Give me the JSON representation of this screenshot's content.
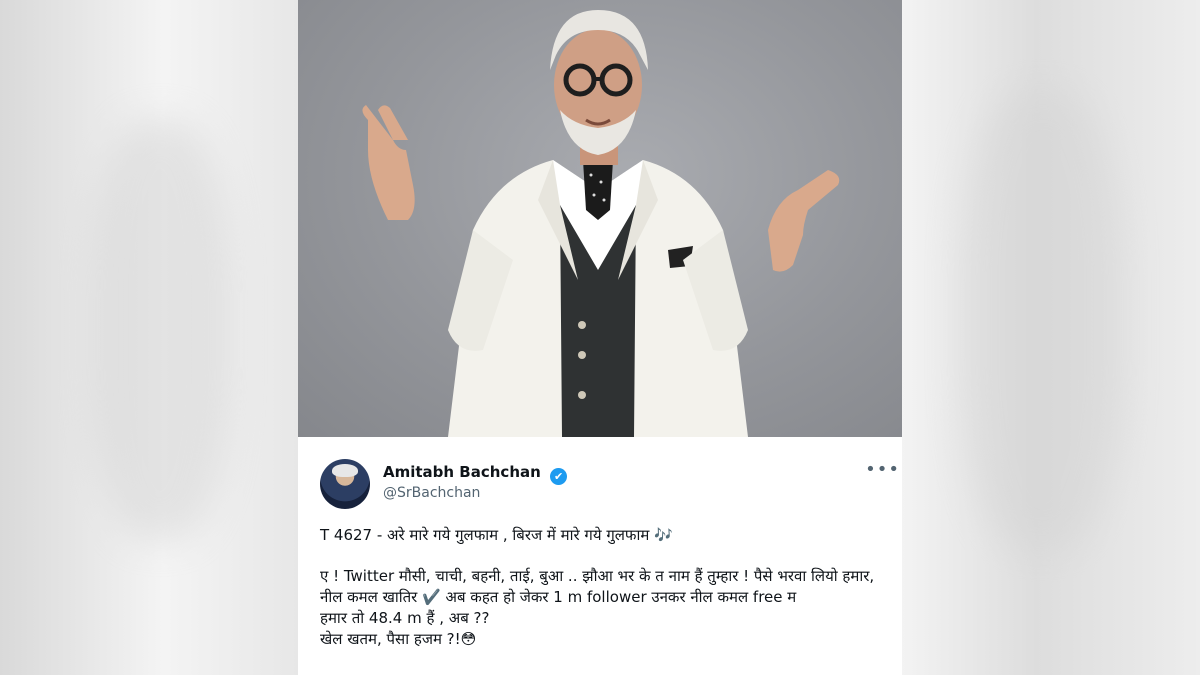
{
  "tweet": {
    "author_name": "Amitabh Bachchan",
    "verified_icon": "✔",
    "handle": "@SrBachchan",
    "more_icon": "•••",
    "line1": "T 4627 - अरे मारे गये गुलफाम  , बिरज में मारे गये गुलफाम 🎶",
    "line2": "ए ! Twitter मौसी, चाची, बहनी, ताई, बुआ .. झौआ भर के त नाम हैं तुम्हार  ! पैसे भरवा लियो हमार, नील कमल खातिर  ✔️ अब कहत हो  जेकर 1 m follower  उनकर नील कमल free म",
    "line3": "हमार तो 48.4 m हैं  , अब  ??",
    "line4": "खेल खतम, पैसा हजम ?!😳"
  },
  "colors": {
    "verified": "#1d9bf0",
    "text": "#0f1419",
    "muted": "#536471",
    "photo_bg": "#94969b"
  }
}
